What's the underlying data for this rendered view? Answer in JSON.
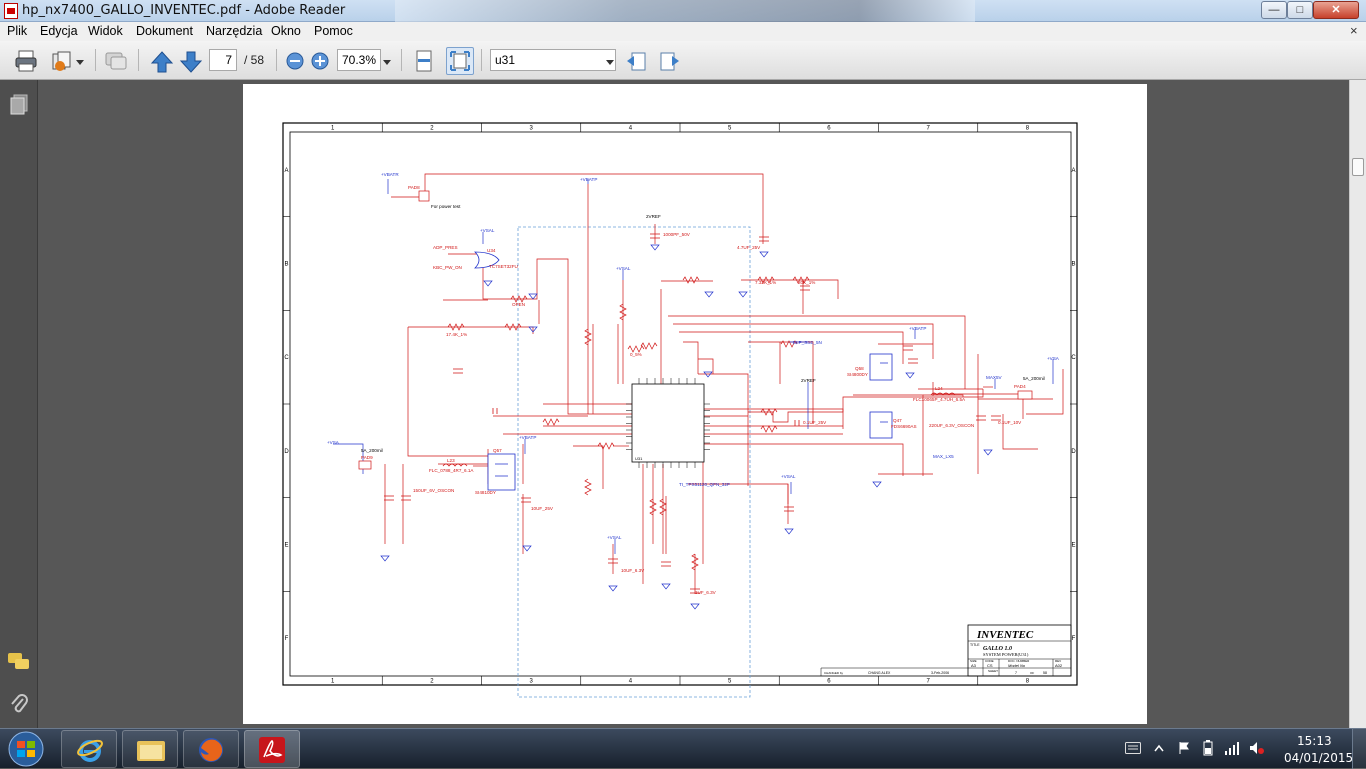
{
  "window": {
    "title": "hp_nx7400_GALLO_INVENTEC.pdf - Adobe Reader",
    "minimize": "—",
    "maximize": "□",
    "close": "✕"
  },
  "menu": {
    "items": [
      "Plik",
      "Edycja",
      "Widok",
      "Dokument",
      "Narzędzia",
      "Okno",
      "Pomoc"
    ],
    "close_doc": "×"
  },
  "toolbar": {
    "page_current": "7",
    "page_total": "/ 58",
    "zoom": "70.3%",
    "search_value": "u31"
  },
  "schematic": {
    "cols": [
      "1",
      "2",
      "3",
      "4",
      "5",
      "6",
      "7",
      "8"
    ],
    "rows": [
      "A",
      "B",
      "C",
      "D",
      "E",
      "F"
    ],
    "company": "INVENTEC",
    "title_label": "TITLE",
    "project": "GALLO 1.0",
    "subtitle": "SYSTEM POWER(U31)",
    "size_label": "SIZE",
    "size": "A3",
    "code_label": "CODE",
    "code": "CS",
    "doc_label": "DOC. NUMBER",
    "doc": "Model No",
    "rev_label": "REV",
    "rev": "A02",
    "sheet_label": "SHEET",
    "sheet": "7",
    "of_label": "OF",
    "of": "58",
    "changed_label": "CHANGED by",
    "changed": "CHANG ALEX",
    "date": "3-Feb-2006",
    "ic_label": "TI_TPS51120_QFN_32P",
    "ic_name": "U31",
    "labels": {
      "vbatr": "+VBATR",
      "vbatp": "+VBATP",
      "vbatp2": "+VBATP",
      "vbatp3": "+VBATP",
      "vsal": "+VSAL",
      "vsal2": "+VSAL",
      "vsal3": "+VSAL",
      "vsal4": "+VSAL",
      "vsa": "+VSA",
      "vsa2": "+VSA",
      "vref": "2VREF",
      "vref2": "2VREF",
      "max5v": "MAX5V",
      "adp_pres": "ADP_PRES",
      "kbc_pw_on": "KBC_PW_ON",
      "for_power_test": "For power test",
      "pad_a": "PAD8",
      "pad_b": "PAD9",
      "pad_c": "PAD4",
      "u34": "U34",
      "u34_part": "TC7SET32FU",
      "q57": "Q57",
      "q57_part": "SI4810DY",
      "q58": "Q58",
      "q58_part": "SI4800DY",
      "q47": "Q47",
      "q47_part": "FDS6690AS",
      "l23": "L23",
      "l24": "L24",
      "l23_part": "FLC_0788_4R7_6.1A",
      "l24_part": "FLC10065P_4.7UH_6.5A",
      "amp_a": "5A_200mil",
      "amp_b": "5A_200mil",
      "max_lx5": "MAX_LX5",
      "blp_sse": "BLP_SSE_5N",
      "cap_a": "4.7UF_25V",
      "cap_b": "1000PF_50V",
      "cap_c": "10UF_25V",
      "cap_d": "0.1UF_25V",
      "cap_e": "10UF_6.3V",
      "cap_f": "150UF_6V_OSCON",
      "cap_g": "220UF_6.3V_OSCON",
      "cap_h": "0.1UF_10V",
      "cap_i": "1UF_6.3V",
      "res_a": "7.32K_1%",
      "res_b": "17.4K_1%",
      "res_c": "20K_1%",
      "res_d": "OPEN",
      "res_e": "0_5%"
    }
  },
  "taskbar": {
    "time": "15:13",
    "date": "04/01/2015"
  }
}
